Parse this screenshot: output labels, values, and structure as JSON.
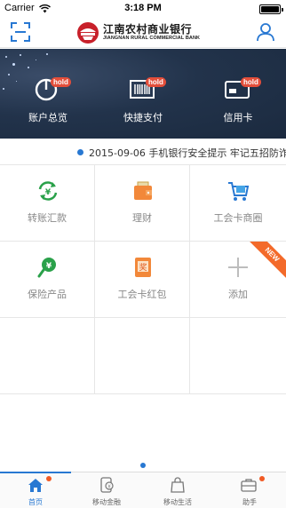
{
  "status_bar": {
    "carrier": "Carrier",
    "time": "3:18 PM",
    "battery_level": 1.0
  },
  "header": {
    "logo_cn": "江南农村商业银行",
    "logo_en": "JIANGNAN RURAL COMMERCIAL BANK",
    "scan_icon": "scan-icon",
    "user_icon": "user-icon"
  },
  "banner": {
    "items": [
      {
        "label": "账户总览",
        "badge": "hold",
        "icon": "pie-chart-icon"
      },
      {
        "label": "快捷支付",
        "badge": "hold",
        "icon": "barcode-icon"
      },
      {
        "label": "信用卡",
        "badge": "hold",
        "icon": "credit-card-icon"
      }
    ]
  },
  "notice": {
    "text": "2015-09-06 手机银行安全提示 牢记五招防诈"
  },
  "grid": {
    "items": [
      {
        "label": "转账汇款",
        "icon": "transfer-icon"
      },
      {
        "label": "理财",
        "icon": "wallet-icon"
      },
      {
        "label": "工会卡商圈",
        "icon": "shopping-cart-icon"
      },
      {
        "label": "保险产品",
        "icon": "insurance-icon"
      },
      {
        "label": "工会卡红包",
        "icon": "red-envelope-icon",
        "icon_text": "奖"
      },
      {
        "label": "添加",
        "icon": "plus-icon",
        "ribbon": "NEW"
      }
    ]
  },
  "tabbar": {
    "tabs": [
      {
        "label": "首页",
        "icon": "home-icon",
        "active": true
      },
      {
        "label": "移动金融",
        "icon": "mobile-finance-icon"
      },
      {
        "label": "移动生活",
        "icon": "shopping-bag-icon"
      },
      {
        "label": "助手",
        "icon": "briefcase-icon"
      }
    ]
  },
  "colors": {
    "accent": "#2878d2",
    "banner_bg": "#22334b",
    "badge": "#e34e3a",
    "ribbon": "#f36a2a"
  }
}
